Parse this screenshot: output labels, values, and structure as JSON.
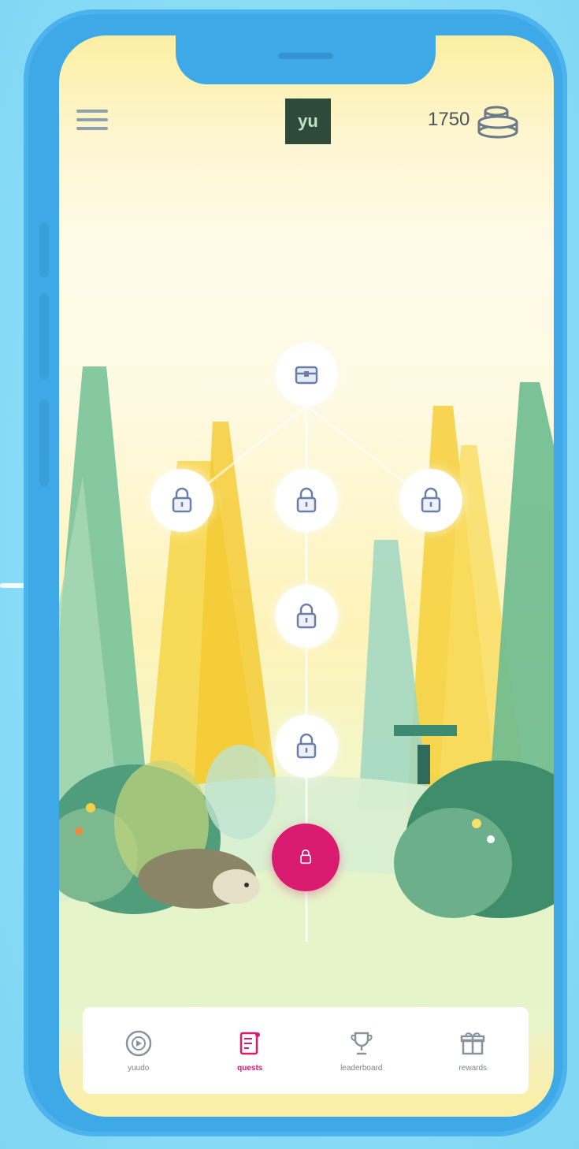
{
  "header": {
    "logo_text": "yu",
    "coin_count": "1750",
    "icons": [
      "menu-icon",
      "coins-icon"
    ]
  },
  "map": {
    "nodes": [
      {
        "name": "treasure-chest-node",
        "state": "locked",
        "icon": "chest-icon"
      },
      {
        "name": "lock-node-left",
        "state": "locked",
        "icon": "lock-icon"
      },
      {
        "name": "lock-node-center",
        "state": "locked",
        "icon": "lock-icon"
      },
      {
        "name": "lock-node-right",
        "state": "locked",
        "icon": "lock-icon"
      },
      {
        "name": "lock-node-middle",
        "state": "locked",
        "icon": "lock-icon"
      },
      {
        "name": "lock-node-lower",
        "state": "locked",
        "icon": "lock-icon"
      },
      {
        "name": "current-level-node",
        "state": "active",
        "icon": "level-icon"
      }
    ]
  },
  "bottom_nav": {
    "items": [
      {
        "label": "yuudo",
        "icon": "dial-icon",
        "active": false
      },
      {
        "label": "quests",
        "icon": "quest-scroll-icon",
        "active": true
      },
      {
        "label": "leaderboard",
        "icon": "trophy-icon",
        "active": false
      },
      {
        "label": "rewards",
        "icon": "gift-icon",
        "active": false
      }
    ]
  },
  "colors": {
    "phone_frame": "#3fa8e6",
    "background": "#8adcf6",
    "accent_pink": "#d81b6f",
    "lock_node_icon": "#6a7fa8",
    "logo_bg": "#2e4a3a"
  }
}
